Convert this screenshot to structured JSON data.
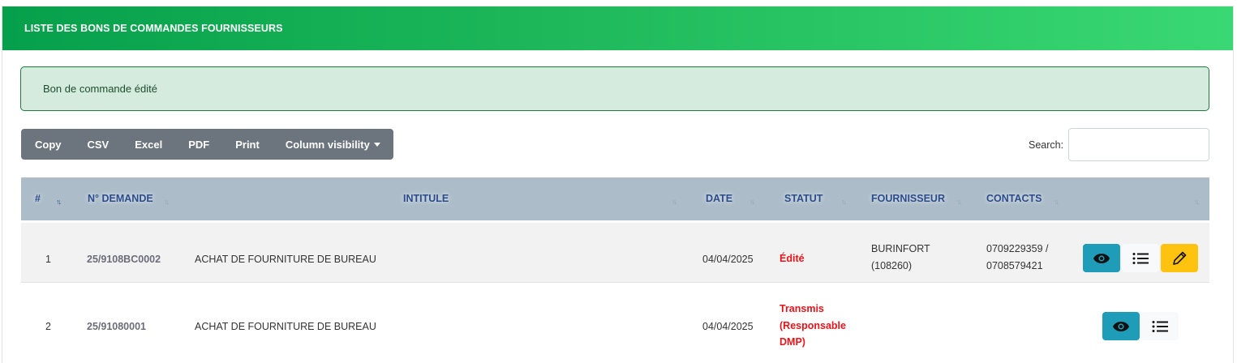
{
  "header": {
    "title": "LISTE DES BONS DE COMMANDES FOURNISSEURS"
  },
  "alert": {
    "message": "Bon de commande édité"
  },
  "toolbar": {
    "copy": "Copy",
    "csv": "CSV",
    "excel": "Excel",
    "pdf": "PDF",
    "print": "Print",
    "column_visibility": "Column visibility"
  },
  "search": {
    "label": "Search:",
    "value": ""
  },
  "table": {
    "columns": {
      "num": "#",
      "demande": "N° DEMANDE",
      "intitule": "INTITULE",
      "date": "DATE",
      "statut": "STATUT",
      "fournisseur": "FOURNISSEUR",
      "contacts": "CONTACTS"
    },
    "sort_icon": "↑↓",
    "rows": [
      {
        "num": "1",
        "demande": "25/9108BC0002",
        "intitule": "ACHAT DE FOURNITURE DE BUREAU",
        "date": "04/04/2025",
        "statut": [
          "Édité"
        ],
        "fournisseur": [
          "BURINFORT",
          "(108260)"
        ],
        "contacts": [
          "0709229359 /",
          "0708579421"
        ]
      },
      {
        "num": "2",
        "demande": "25/91080001",
        "intitule": "ACHAT DE FOURNITURE DE BUREAU",
        "date": "04/04/2025",
        "statut": [
          "Transmis",
          "(Responsable",
          "DMP)"
        ],
        "fournisseur": [],
        "contacts": []
      }
    ]
  },
  "colors": {
    "header_gradient_start": "#06a04c",
    "header_gradient_end": "#3ad874",
    "status_text": "#e8141b",
    "view_button": "#1e9cb8",
    "edit_button": "#ffc20e",
    "table_header": "#acbdc9"
  },
  "icons": {
    "view": "eye-icon",
    "details": "list-icon",
    "edit": "pencil-icon"
  }
}
